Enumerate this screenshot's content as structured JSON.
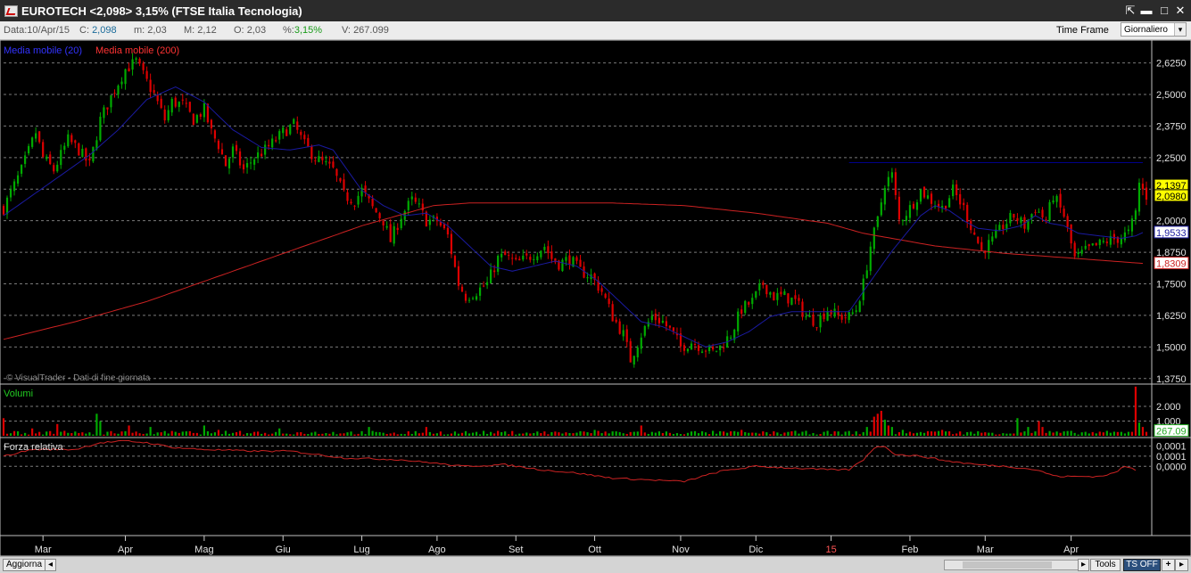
{
  "window": {
    "title": "EUROTECH <2,098> 3,15%  (FTSE Italia Tecnologia)",
    "pin_glyph": "⇱",
    "min_glyph": "▬",
    "max_glyph": "□",
    "close_glyph": "✕"
  },
  "infobar": {
    "date_label": "Data:",
    "date_value": "10/Apr/15",
    "close_label": "C:",
    "close_value": "2,098",
    "min_label": "m:",
    "min_value": "2,03",
    "max_label": "M:",
    "max_value": "2,12",
    "open_label": "O:",
    "open_value": "2,03",
    "pct_label": "%:",
    "pct_value": "3,15%",
    "vol_label": "V:",
    "vol_value": "267.099",
    "timeframe_label": "Time Frame",
    "timeframe_value": "Giornaliero"
  },
  "bottombar": {
    "refresh_label": "Aggiorna",
    "tools_label": "Tools",
    "ts_label": "TS OFF",
    "plus_label": "+",
    "left_glyph": "◂",
    "right_glyph": "▸"
  },
  "colors": {
    "up": "#00aa00",
    "down": "#dd0000",
    "ma20": "#1a1aa0",
    "ma200": "#cc2222",
    "rs": "#cc2222",
    "resistance": "#00008b",
    "grid": "#7a7a7a",
    "label_last": "#ffff00"
  },
  "chart_data": {
    "type": "line",
    "subtype": "candlestick",
    "legend_ma20": "Media mobile (20)",
    "legend_ma200": "Media mobile (200)",
    "watermark": "© VisualTrader - Dati di fine giornata",
    "x_ticks": [
      "Mar",
      "Apr",
      "Mag",
      "Giu",
      "Lug",
      "Ago",
      "Set",
      "Ott",
      "Nov",
      "Dic",
      "15",
      "Feb",
      "Mar",
      "Apr"
    ],
    "x_tick_index": [
      11,
      34,
      56,
      78,
      100,
      121,
      143,
      165,
      189,
      210,
      231,
      253,
      274,
      298
    ],
    "x_range": [
      0,
      320
    ],
    "price_ticks": [
      {
        "v": 2.625,
        "label": "2,6250"
      },
      {
        "v": 2.5,
        "label": "2,5000"
      },
      {
        "v": 2.375,
        "label": "2,3750"
      },
      {
        "v": 2.25,
        "label": "2,2500"
      },
      {
        "v": 2.125,
        "label": "2,1250"
      },
      {
        "v": 2.0,
        "label": "2,0000"
      },
      {
        "v": 1.875,
        "label": "1,8750"
      },
      {
        "v": 1.75,
        "label": "1,7500"
      },
      {
        "v": 1.625,
        "label": "1,6250"
      },
      {
        "v": 1.5,
        "label": "1,5000"
      },
      {
        "v": 1.375,
        "label": "1,3750"
      }
    ],
    "price_range": [
      1.36,
      2.68
    ],
    "last_labels": [
      {
        "v": 2.1397,
        "label": "2,1397",
        "style": "yellow"
      },
      {
        "v": 2.098,
        "label": "2,0980",
        "style": "yellow"
      },
      {
        "v": 1.9533,
        "label": "1,9533",
        "style": "blue"
      },
      {
        "v": 1.8309,
        "label": "1,8309",
        "style": "red"
      }
    ],
    "resistance": {
      "v": 2.23,
      "from": 236,
      "to": 318
    },
    "price_key": [
      [
        0,
        2.05
      ],
      [
        5,
        2.2
      ],
      [
        9,
        2.35
      ],
      [
        11,
        2.25
      ],
      [
        14,
        2.2
      ],
      [
        18,
        2.32
      ],
      [
        21,
        2.28
      ],
      [
        24,
        2.22
      ],
      [
        27,
        2.4
      ],
      [
        31,
        2.52
      ],
      [
        34,
        2.6
      ],
      [
        37,
        2.63
      ],
      [
        40,
        2.55
      ],
      [
        42,
        2.5
      ],
      [
        45,
        2.4
      ],
      [
        47,
        2.47
      ],
      [
        50,
        2.46
      ],
      [
        53,
        2.4
      ],
      [
        56,
        2.44
      ],
      [
        58,
        2.35
      ],
      [
        60,
        2.3
      ],
      [
        62,
        2.22
      ],
      [
        64,
        2.28
      ],
      [
        67,
        2.2
      ],
      [
        70,
        2.25
      ],
      [
        73,
        2.28
      ],
      [
        76,
        2.32
      ],
      [
        78,
        2.35
      ],
      [
        81,
        2.38
      ],
      [
        84,
        2.3
      ],
      [
        87,
        2.25
      ],
      [
        90,
        2.22
      ],
      [
        92,
        2.2
      ],
      [
        95,
        2.1
      ],
      [
        98,
        2.08
      ],
      [
        100,
        2.12
      ],
      [
        103,
        2.05
      ],
      [
        106,
        2.0
      ],
      [
        108,
        1.92
      ],
      [
        111,
        2.02
      ],
      [
        114,
        2.08
      ],
      [
        116,
        2.05
      ],
      [
        118,
        2.0
      ],
      [
        121,
        2.0
      ],
      [
        124,
        1.94
      ],
      [
        127,
        1.75
      ],
      [
        129,
        1.7
      ],
      [
        132,
        1.72
      ],
      [
        135,
        1.75
      ],
      [
        138,
        1.85
      ],
      [
        140,
        1.86
      ],
      [
        143,
        1.83
      ],
      [
        146,
        1.85
      ],
      [
        149,
        1.88
      ],
      [
        151,
        1.9
      ],
      [
        153,
        1.85
      ],
      [
        155,
        1.83
      ],
      [
        158,
        1.85
      ],
      [
        161,
        1.8
      ],
      [
        164,
        1.78
      ],
      [
        167,
        1.72
      ],
      [
        170,
        1.62
      ],
      [
        173,
        1.55
      ],
      [
        175,
        1.45
      ],
      [
        178,
        1.55
      ],
      [
        181,
        1.62
      ],
      [
        184,
        1.6
      ],
      [
        187,
        1.55
      ],
      [
        189,
        1.5
      ],
      [
        192,
        1.52
      ],
      [
        195,
        1.5
      ],
      [
        198,
        1.48
      ],
      [
        200,
        1.5
      ],
      [
        203,
        1.55
      ],
      [
        206,
        1.65
      ],
      [
        209,
        1.68
      ],
      [
        212,
        1.75
      ],
      [
        215,
        1.7
      ],
      [
        218,
        1.7
      ],
      [
        221,
        1.68
      ],
      [
        224,
        1.62
      ],
      [
        227,
        1.6
      ],
      [
        230,
        1.65
      ],
      [
        233,
        1.62
      ],
      [
        236,
        1.62
      ],
      [
        238,
        1.65
      ],
      [
        240,
        1.75
      ],
      [
        242,
        1.9
      ],
      [
        244,
        2.0
      ],
      [
        246,
        2.15
      ],
      [
        248,
        2.18
      ],
      [
        250,
        2.0
      ],
      [
        253,
        2.05
      ],
      [
        256,
        2.12
      ],
      [
        259,
        2.08
      ],
      [
        262,
        2.05
      ],
      [
        265,
        2.12
      ],
      [
        268,
        2.05
      ],
      [
        270,
        1.98
      ],
      [
        273,
        1.88
      ],
      [
        276,
        1.92
      ],
      [
        279,
        1.98
      ],
      [
        282,
        2.02
      ],
      [
        285,
        1.98
      ],
      [
        288,
        2.05
      ],
      [
        291,
        2.0
      ],
      [
        293,
        2.1
      ],
      [
        296,
        2.02
      ],
      [
        299,
        1.85
      ],
      [
        302,
        1.88
      ],
      [
        305,
        1.9
      ],
      [
        308,
        1.92
      ],
      [
        311,
        1.93
      ],
      [
        314,
        1.95
      ],
      [
        316,
        2.03
      ],
      [
        317,
        2.15
      ],
      [
        318,
        2.12
      ],
      [
        319,
        2.098
      ]
    ],
    "ma20_key": [
      [
        0,
        2.02
      ],
      [
        8,
        2.1
      ],
      [
        16,
        2.18
      ],
      [
        24,
        2.26
      ],
      [
        32,
        2.36
      ],
      [
        40,
        2.48
      ],
      [
        48,
        2.53
      ],
      [
        56,
        2.47
      ],
      [
        64,
        2.36
      ],
      [
        72,
        2.29
      ],
      [
        80,
        2.28
      ],
      [
        88,
        2.3
      ],
      [
        92,
        2.28
      ],
      [
        96,
        2.2
      ],
      [
        100,
        2.12
      ],
      [
        106,
        2.06
      ],
      [
        112,
        2.02
      ],
      [
        118,
        2.03
      ],
      [
        124,
        1.98
      ],
      [
        130,
        1.9
      ],
      [
        136,
        1.82
      ],
      [
        142,
        1.8
      ],
      [
        148,
        1.82
      ],
      [
        154,
        1.84
      ],
      [
        160,
        1.82
      ],
      [
        166,
        1.76
      ],
      [
        172,
        1.68
      ],
      [
        178,
        1.6
      ],
      [
        184,
        1.58
      ],
      [
        190,
        1.54
      ],
      [
        196,
        1.5
      ],
      [
        202,
        1.52
      ],
      [
        208,
        1.56
      ],
      [
        214,
        1.62
      ],
      [
        220,
        1.64
      ],
      [
        226,
        1.64
      ],
      [
        232,
        1.64
      ],
      [
        236,
        1.64
      ],
      [
        240,
        1.72
      ],
      [
        244,
        1.8
      ],
      [
        248,
        1.88
      ],
      [
        252,
        1.95
      ],
      [
        256,
        2.02
      ],
      [
        260,
        2.06
      ],
      [
        264,
        2.04
      ],
      [
        268,
        2.0
      ],
      [
        272,
        1.97
      ],
      [
        278,
        1.96
      ],
      [
        284,
        1.98
      ],
      [
        288,
        2.02
      ],
      [
        292,
        1.99
      ],
      [
        296,
        1.98
      ],
      [
        300,
        1.95
      ],
      [
        306,
        1.94
      ],
      [
        312,
        1.93
      ],
      [
        316,
        1.94
      ],
      [
        318,
        1.9533
      ]
    ],
    "ma200_key": [
      [
        0,
        1.53
      ],
      [
        20,
        1.6
      ],
      [
        40,
        1.68
      ],
      [
        60,
        1.78
      ],
      [
        80,
        1.88
      ],
      [
        100,
        1.98
      ],
      [
        120,
        2.06
      ],
      [
        130,
        2.07
      ],
      [
        150,
        2.07
      ],
      [
        170,
        2.07
      ],
      [
        190,
        2.06
      ],
      [
        210,
        2.03
      ],
      [
        230,
        1.99
      ],
      [
        240,
        1.95
      ],
      [
        260,
        1.9
      ],
      [
        280,
        1.87
      ],
      [
        300,
        1.85
      ],
      [
        318,
        1.8309
      ]
    ],
    "volume": {
      "label": "Volumi",
      "ticks": [
        {
          "v": 2000000,
          "label": "2.000"
        },
        {
          "v": 1000000,
          "label": "1.000"
        }
      ],
      "last_label": "267.09",
      "range": [
        0,
        3400000
      ],
      "spikes": [
        [
          0,
          1200000
        ],
        [
          8,
          500000
        ],
        [
          15,
          800000
        ],
        [
          26,
          1500000
        ],
        [
          27,
          1000000
        ],
        [
          35,
          700000
        ],
        [
          41,
          600000
        ],
        [
          56,
          700000
        ],
        [
          60,
          400000
        ],
        [
          77,
          500000
        ],
        [
          102,
          600000
        ],
        [
          118,
          600000
        ],
        [
          165,
          400000
        ],
        [
          178,
          700000
        ],
        [
          206,
          400000
        ],
        [
          212,
          300000
        ],
        [
          241,
          600000
        ],
        [
          243,
          1300000
        ],
        [
          244,
          1500000
        ],
        [
          245,
          1700000
        ],
        [
          246,
          1100000
        ],
        [
          247,
          700000
        ],
        [
          248,
          600000
        ],
        [
          251,
          400000
        ],
        [
          259,
          300000
        ],
        [
          262,
          400000
        ],
        [
          283,
          1200000
        ],
        [
          286,
          600000
        ],
        [
          289,
          1000000
        ],
        [
          290,
          600000
        ],
        [
          316,
          3350000
        ],
        [
          317,
          900000
        ],
        [
          318,
          600000
        ],
        [
          319,
          267099
        ]
      ]
    },
    "relative_strength": {
      "label": "Forza relativa",
      "ticks": [
        {
          "y": 0.00012,
          "label": "0,0001"
        },
        {
          "y": 6e-05,
          "label": "0,0001"
        },
        {
          "y": 0.0,
          "label": "0,0000"
        }
      ],
      "range": [
        -0.0004,
        0.00016
      ],
      "key": [
        [
          0,
          6e-05
        ],
        [
          8,
          0.0001
        ],
        [
          20,
          0.0001
        ],
        [
          27,
          0.00014
        ],
        [
          34,
          0.00015
        ],
        [
          40,
          0.00014
        ],
        [
          48,
          0.00011
        ],
        [
          56,
          0.0001
        ],
        [
          70,
          9e-05
        ],
        [
          80,
          9e-05
        ],
        [
          95,
          5e-05
        ],
        [
          110,
          4e-05
        ],
        [
          120,
          2e-05
        ],
        [
          128,
          0.0
        ],
        [
          140,
          1e-05
        ],
        [
          150,
          -2e-05
        ],
        [
          160,
          -4e-05
        ],
        [
          170,
          -7e-05
        ],
        [
          180,
          -8e-05
        ],
        [
          190,
          -9e-05
        ],
        [
          200,
          -3e-05
        ],
        [
          210,
          0.0
        ],
        [
          220,
          -1e-05
        ],
        [
          230,
          -2e-05
        ],
        [
          236,
          -2e-05
        ],
        [
          240,
          4e-05
        ],
        [
          243,
          0.00011
        ],
        [
          246,
          0.00012
        ],
        [
          249,
          7e-05
        ],
        [
          256,
          6e-05
        ],
        [
          264,
          3e-05
        ],
        [
          272,
          1e-05
        ],
        [
          280,
          0.0
        ],
        [
          288,
          -2e-05
        ],
        [
          294,
          -6e-05
        ],
        [
          300,
          -6e-05
        ],
        [
          306,
          -6e-05
        ],
        [
          310,
          -4e-05
        ],
        [
          313,
          0.0
        ],
        [
          316,
          -2e-05
        ]
      ]
    }
  }
}
